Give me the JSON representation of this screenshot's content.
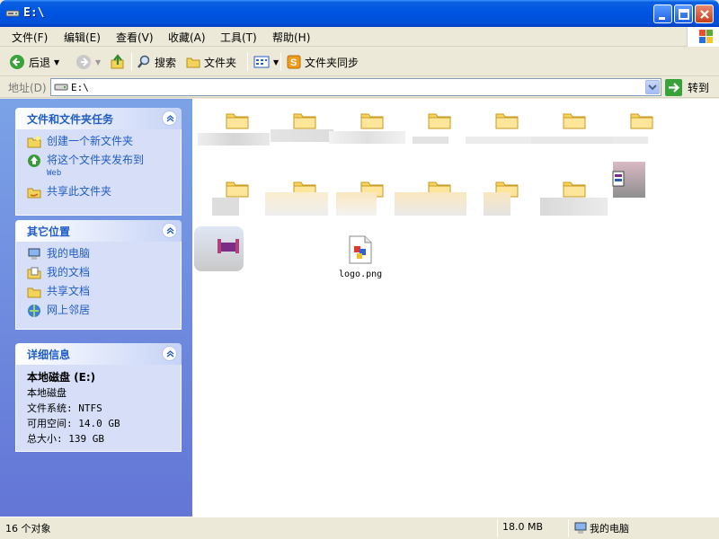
{
  "window": {
    "title": "E:\\"
  },
  "menu": [
    "文件(F)",
    "编辑(E)",
    "查看(V)",
    "收藏(A)",
    "工具(T)",
    "帮助(H)"
  ],
  "toolbar": {
    "back": "后退",
    "search": "搜索",
    "folders": "文件夹",
    "sync": "文件夹同步"
  },
  "address": {
    "label": "地址(D)",
    "value": "E:\\",
    "go": "转到"
  },
  "tasks": {
    "title": "文件和文件夹任务",
    "items": [
      {
        "label": "创建一个新文件夹",
        "icon": "new-folder-icon"
      },
      {
        "label": "将这个文件夹发布到",
        "sub": "Web",
        "icon": "publish-web-icon"
      },
      {
        "label": "共享此文件夹",
        "icon": "share-folder-icon"
      }
    ]
  },
  "places": {
    "title": "其它位置",
    "items": [
      {
        "label": "我的电脑",
        "icon": "my-computer-icon"
      },
      {
        "label": "我的文档",
        "icon": "my-documents-icon"
      },
      {
        "label": "共享文档",
        "icon": "shared-documents-icon"
      },
      {
        "label": "网上邻居",
        "icon": "network-places-icon"
      }
    ]
  },
  "details": {
    "title": "详细信息",
    "name": "本地磁盘 (E:)",
    "type": "本地磁盘",
    "fs": "文件系统: NTFS",
    "free": "可用空间: 14.0 GB",
    "total": "总大小: 139 GB"
  },
  "files": {
    "logo": "logo.png"
  },
  "status": {
    "count": "16 个对象",
    "size": "18.0 MB",
    "location": "我的电脑"
  },
  "colors": {
    "titlebar": "#0054e3",
    "taskpane": "#6375d6",
    "link": "#215dc6"
  }
}
